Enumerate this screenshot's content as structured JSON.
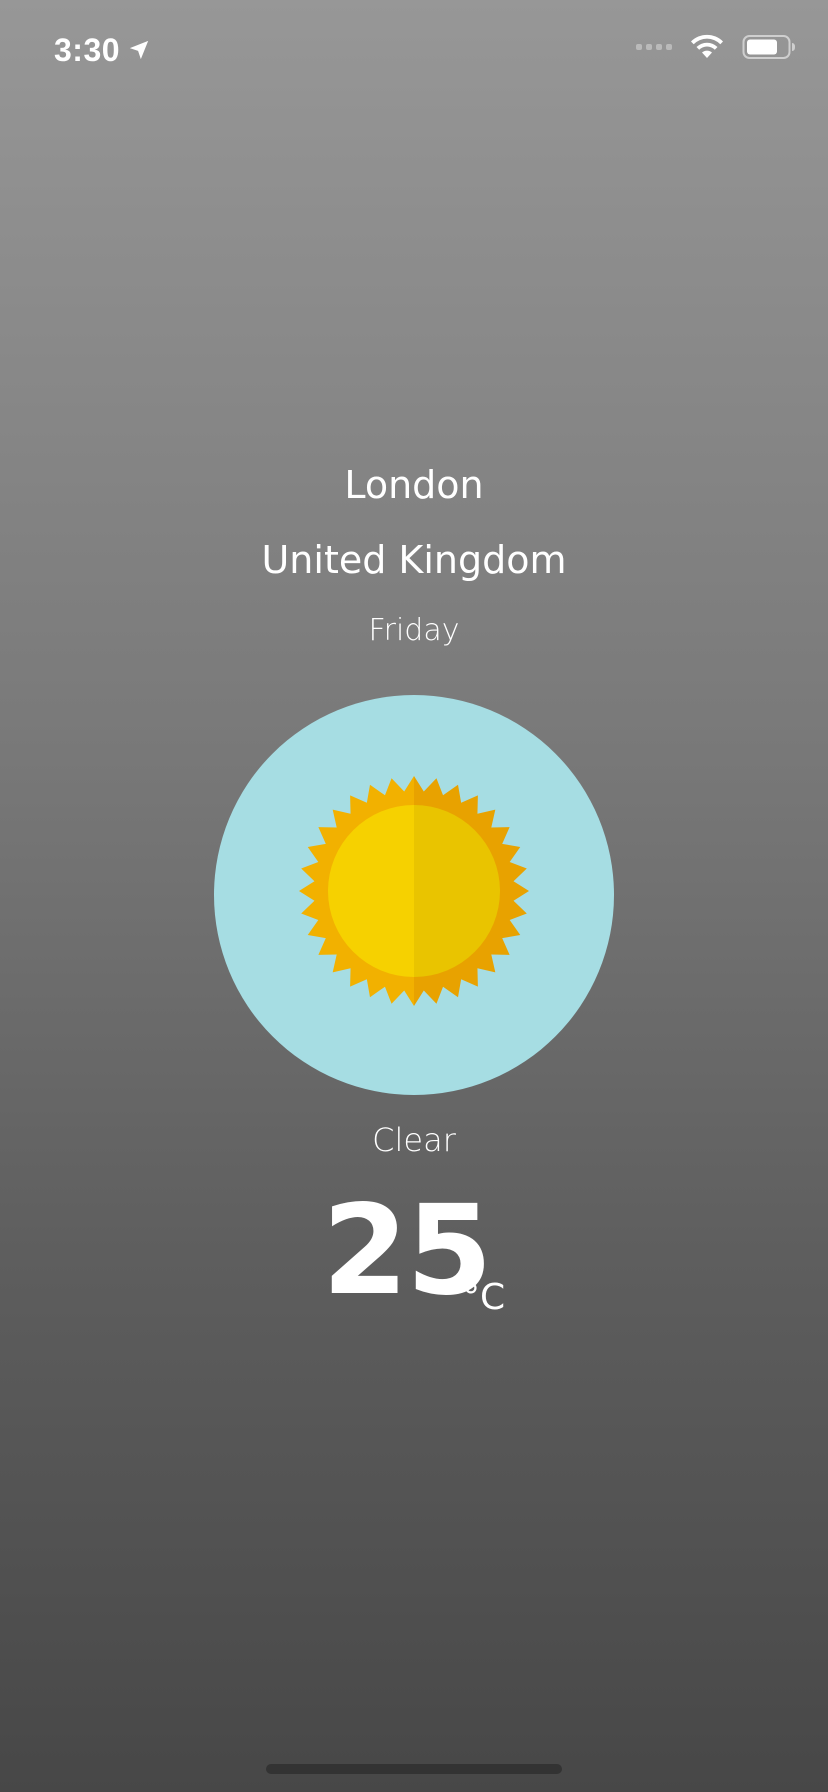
{
  "status_bar": {
    "time": "3:30",
    "location_icon": "location-arrow-icon",
    "signal_icon": "cellular-signal-icon",
    "wifi_icon": "wifi-icon",
    "battery_icon": "battery-icon"
  },
  "weather": {
    "city": "London",
    "country": "United Kingdom",
    "day": "Friday",
    "icon": "sun-icon",
    "condition": "Clear",
    "temperature": "25",
    "unit": "°C"
  },
  "colors": {
    "circle_background": "#a6dde3",
    "sun_outer": "#f2b100",
    "sun_inner": "#f6d100",
    "background_top": "#979797",
    "background_bottom": "#474747"
  }
}
